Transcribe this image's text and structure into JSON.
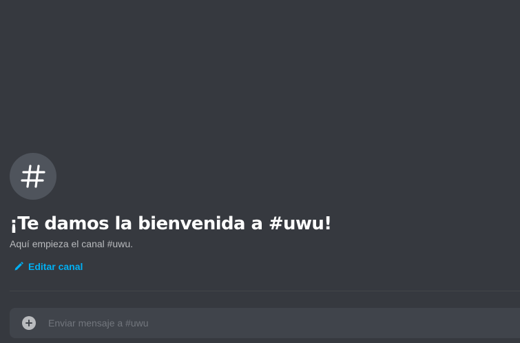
{
  "channel": {
    "name": "uwu",
    "icon": "hashtag-icon"
  },
  "welcome": {
    "title": "¡Te damos la bienvenida a #uwu!",
    "description": "Aquí empieza el canal #uwu.",
    "edit_label": "Editar canal",
    "edit_icon": "pencil-icon"
  },
  "composer": {
    "attach_icon": "plus-circle-icon",
    "placeholder": "Enviar mensaje a #uwu",
    "value": ""
  },
  "colors": {
    "background": "#36393f",
    "avatar_bg": "#4f545c",
    "title": "#ffffff",
    "description": "#b9bbbe",
    "link": "#00b0f4",
    "input_bg": "#40444b",
    "placeholder": "#72767d"
  }
}
